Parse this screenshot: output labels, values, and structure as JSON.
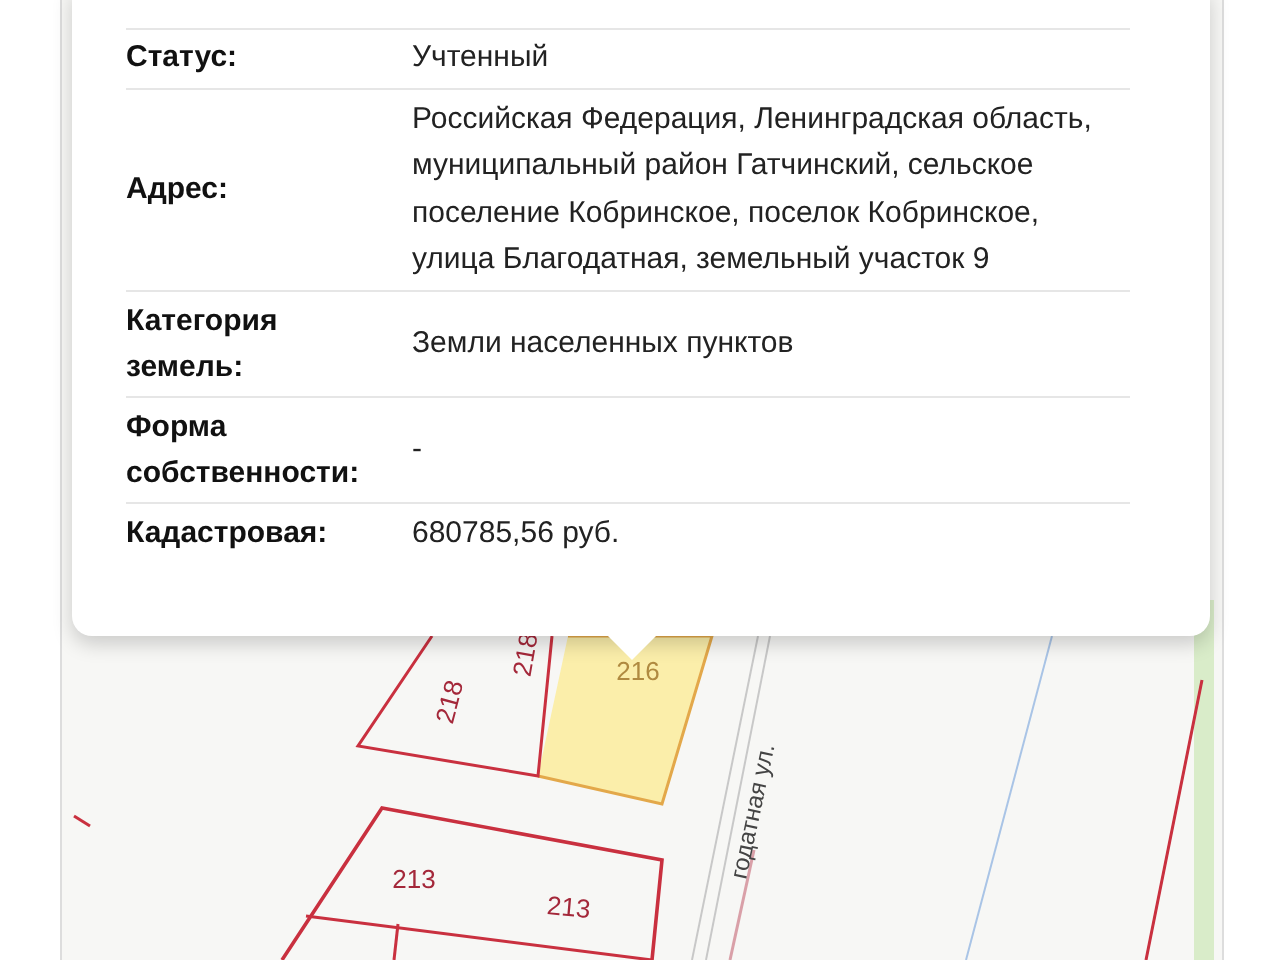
{
  "popup": {
    "rows": [
      {
        "label": "Статус:",
        "value": "Учтенный"
      },
      {
        "label": "Адрес:",
        "value": "Российская Федерация, Ленинградская область, муниципальный район Гатчинский, сельское поселение Кобринское, поселок Кобринское, улица Благодатная, земельный участок 9"
      },
      {
        "label": "Категория земель:",
        "value": "Земли населенных пунктов"
      },
      {
        "label": "Форма собственности:",
        "value": "-"
      },
      {
        "label": "Кадастровая:",
        "value": "680785,56 руб."
      }
    ]
  },
  "map": {
    "parcel_labels": [
      {
        "text": "218",
        "selected": false
      },
      {
        "text": "218",
        "selected": false
      },
      {
        "text": "216",
        "selected": true
      },
      {
        "text": "213",
        "selected": false
      },
      {
        "text": "213",
        "selected": false
      }
    ],
    "street": "годатная ул."
  }
}
